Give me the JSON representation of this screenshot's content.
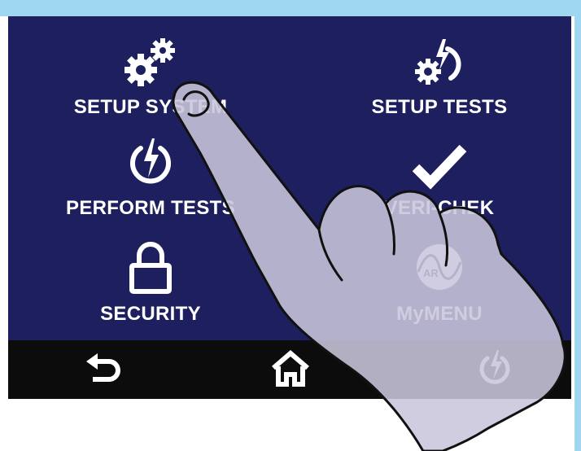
{
  "menu": {
    "setup_system": "SETUP SYSTEM",
    "setup_tests": "SETUP TESTS",
    "perform_tests": "PERFORM TESTS",
    "veri_chek": "VERI-CHEK",
    "security": "SECURITY",
    "mymenu": "MyMENU",
    "ar_logo_text": "AR"
  },
  "nav": {
    "back_icon": "back-arrow-icon",
    "home_icon": "home-icon",
    "power_icon": "power-icon"
  },
  "colors": {
    "screen_bg": "#1d1f5e",
    "navbar_bg": "#0c0c0c",
    "frame": "#9fd6f0",
    "text": "#ffffff",
    "hand_overlay": "#c9c6dc"
  }
}
